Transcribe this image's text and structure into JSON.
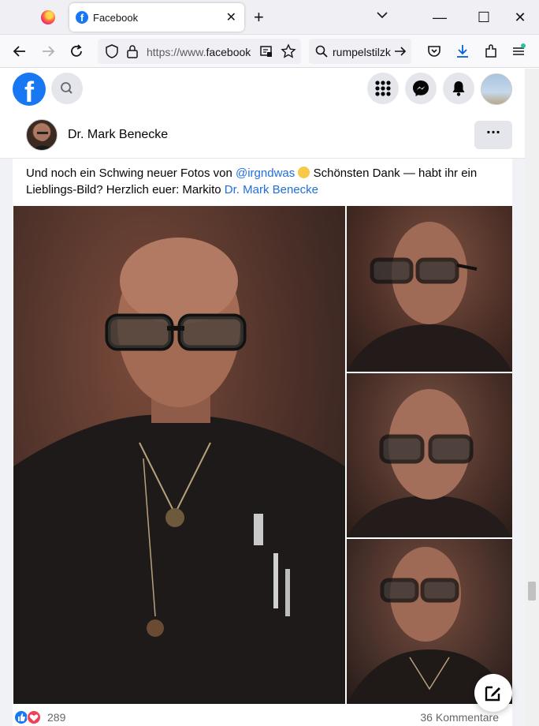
{
  "browser": {
    "tab": {
      "title": "Facebook",
      "close": "✕"
    },
    "new_tab": "+",
    "window": {
      "minimize": "—",
      "maximize": "☐",
      "close": "✕"
    },
    "url": {
      "scheme": "https://www.",
      "host": "facebook"
    },
    "search_query": "rumpelstilzk"
  },
  "facebook": {
    "profile": {
      "name": "Dr. Mark Benecke"
    },
    "post": {
      "caption_start": "Und noch ein Schwing neuer Fotos von ",
      "mention": "@irgndwas",
      "caption_mid": " Schönsten Dank — habt ihr ein Lieblings-Bild? Herzlich euer: Markito ",
      "author_link": "Dr. Mark Benecke",
      "reaction_count": "289",
      "comment_count": "36 Kommentare"
    },
    "more_label": "···"
  },
  "colors": {
    "facebook_blue": "#1877f2",
    "link_blue": "#216fdb",
    "love_red": "#f33e58"
  },
  "icons": [
    "firefox-icon",
    "facebook-favicon",
    "back-icon",
    "forward-icon",
    "reload-icon",
    "shield-icon",
    "lock-icon",
    "reader-mode-icon",
    "bookmark-star-icon",
    "search-icon",
    "go-arrow-icon",
    "pocket-icon",
    "download-icon",
    "extensions-icon",
    "app-menu-icon",
    "facebook-logo",
    "menu-grid-icon",
    "messenger-icon",
    "bell-icon",
    "compose-icon",
    "like-icon",
    "love-icon"
  ]
}
